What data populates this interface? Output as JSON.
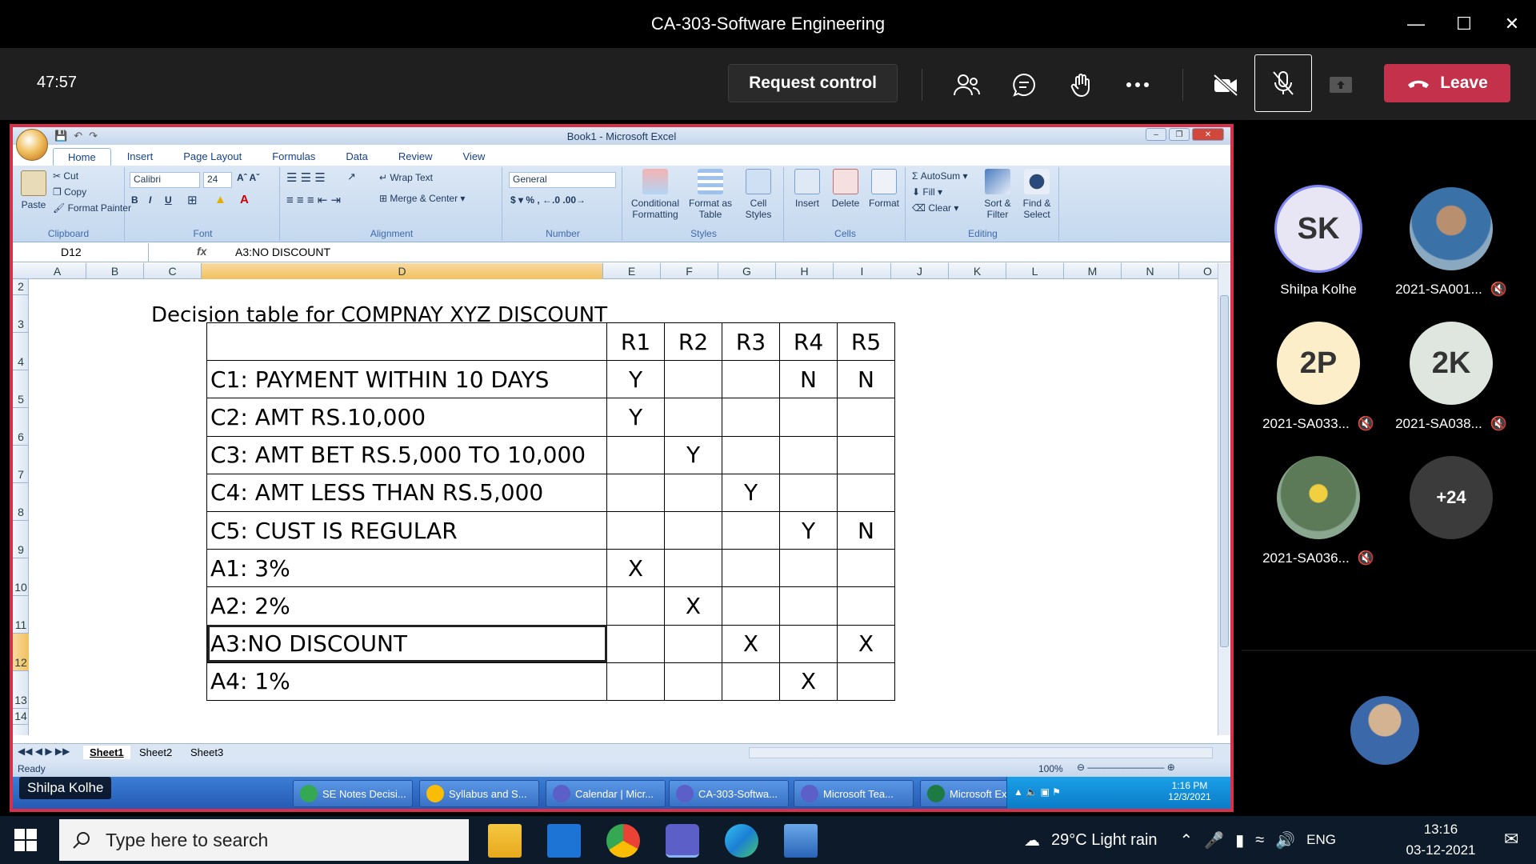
{
  "meeting": {
    "title": "CA-303-Software Engineering",
    "timer": "47:57",
    "request_control": "Request control",
    "leave": "Leave"
  },
  "excel": {
    "window_title": "Book1 - Microsoft Excel",
    "tabs": [
      "Home",
      "Insert",
      "Page Layout",
      "Formulas",
      "Data",
      "Review",
      "View"
    ],
    "ribbon": {
      "clipboard": {
        "paste": "Paste",
        "cut": "Cut",
        "copy": "Copy",
        "format_painter": "Format Painter",
        "label": "Clipboard"
      },
      "font": {
        "name": "Calibri",
        "size": "24",
        "label": "Font"
      },
      "alignment": {
        "wrap": "Wrap Text",
        "merge": "Merge & Center",
        "label": "Alignment"
      },
      "number": {
        "format": "General",
        "label": "Number"
      },
      "styles": {
        "cond": "Conditional Formatting",
        "table": "Format as Table",
        "cell": "Cell Styles",
        "label": "Styles"
      },
      "cells": {
        "insert": "Insert",
        "delete": "Delete",
        "format": "Format",
        "label": "Cells"
      },
      "editing": {
        "autosum": "AutoSum",
        "fill": "Fill",
        "clear": "Clear",
        "sort": "Sort & Filter",
        "find": "Find & Select",
        "label": "Editing"
      }
    },
    "name_box": "D12",
    "formula": "A3:NO DISCOUNT",
    "columns": [
      "A",
      "B",
      "C",
      "D",
      "E",
      "F",
      "G",
      "H",
      "I",
      "J",
      "K",
      "L",
      "M",
      "N",
      "O"
    ],
    "rows": [
      "2",
      "3",
      "4",
      "5",
      "6",
      "7",
      "8",
      "9",
      "10",
      "11",
      "12",
      "13",
      "14"
    ],
    "sheet_title": "Decision table for COMPNAY XYZ DISCOUNT",
    "table": {
      "headers": [
        "",
        "R1",
        "R2",
        "R3",
        "R4",
        "R5"
      ],
      "rows": [
        [
          "C1: PAYMENT WITHIN 10 DAYS",
          "Y",
          "",
          "",
          "N",
          "N"
        ],
        [
          "C2: AMT RS.10,000",
          "Y",
          "",
          "",
          "",
          ""
        ],
        [
          "C3: AMT BET RS.5,000 TO 10,000",
          "",
          "Y",
          "",
          "",
          ""
        ],
        [
          "C4: AMT LESS THAN RS.5,000",
          "",
          "",
          "Y",
          "",
          ""
        ],
        [
          "C5: CUST IS REGULAR",
          "",
          "",
          "",
          "Y",
          "N"
        ],
        [
          "A1: 3%",
          "X",
          "",
          "",
          "",
          ""
        ],
        [
          "A2: 2%",
          "",
          "X",
          "",
          "",
          ""
        ],
        [
          "A3:NO DISCOUNT",
          "",
          "",
          "X",
          "",
          "X"
        ],
        [
          "A4: 1%",
          "",
          "",
          "",
          "X",
          ""
        ]
      ]
    },
    "sheets": [
      "Sheet1",
      "Sheet2",
      "Sheet3"
    ],
    "status": "Ready",
    "zoom": "100%"
  },
  "remote_taskbar": {
    "items": [
      "SE Notes Decisi...",
      "Syllabus and S...",
      "Calendar | Micr...",
      "CA-303-Softwa...",
      "Microsoft Tea...",
      "Microsoft Excel..."
    ],
    "time": "1:16 PM",
    "date": "12/3/2021"
  },
  "presenter": "Shilpa Kolhe",
  "participants": [
    {
      "name": "Shilpa Kolhe",
      "initials": "SK",
      "bg": "#e8e6f4",
      "muted": false
    },
    {
      "name": "2021-SA001...",
      "initials": "",
      "bg": "#6f8fa8",
      "muted": true
    },
    {
      "name": "2021-SA033...",
      "initials": "2P",
      "bg": "#fbeec8",
      "muted": true
    },
    {
      "name": "2021-SA038...",
      "initials": "2K",
      "bg": "#dfe6df",
      "muted": true
    },
    {
      "name": "2021-SA036...",
      "initials": "",
      "bg": "#5c7a58",
      "muted": true
    }
  ],
  "overflow_count": "+24",
  "windows": {
    "search_placeholder": "Type here to search",
    "weather": "29°C  Light rain",
    "lang": "ENG",
    "time": "13:16",
    "date": "03-12-2021"
  }
}
